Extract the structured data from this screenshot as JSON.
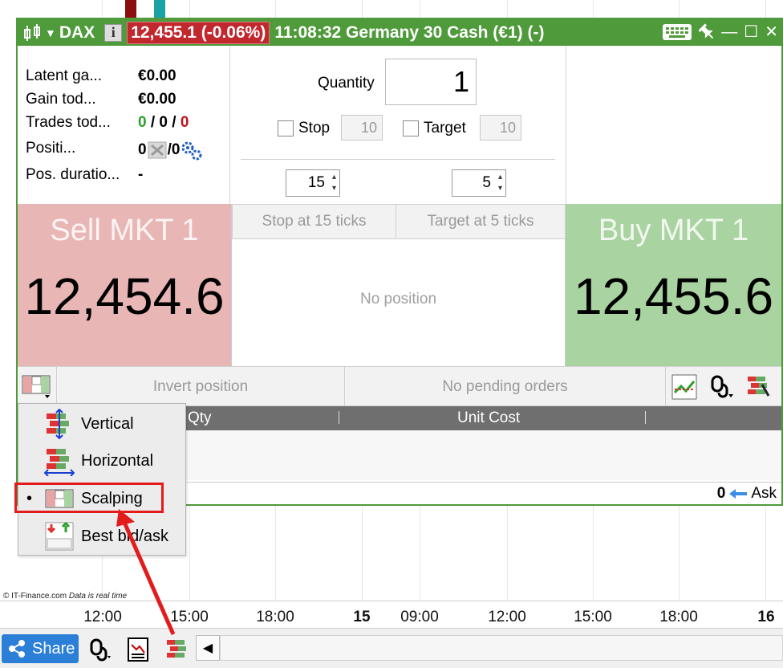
{
  "window": {
    "symbol": "DAX",
    "price_badge": "12,455.1 (-0.06%)",
    "time_and_name": "11:08:32 Germany 30 Cash (€1) (-)",
    "border_color": "#4f9a3a"
  },
  "stats": {
    "latent_gain_label": "Latent ga...",
    "latent_gain_value": "€0.00",
    "gain_today_label": "Gain tod...",
    "gain_today_value": "€0.00",
    "trades_today_label": "Trades tod...",
    "trades_won": "0",
    "trades_sep1": " / ",
    "trades_neutral": "0",
    "trades_sep2": " / ",
    "trades_lost": "0",
    "positions_label": "Positi...",
    "positions_long": "0",
    "positions_sep": " / ",
    "positions_short": "0",
    "pos_duration_label": "Pos. duratio...",
    "pos_duration_value": "-"
  },
  "order": {
    "quantity_label": "Quantity",
    "quantity_value": "1",
    "stop_label": "Stop",
    "stop_value": "10",
    "target_label": "Target",
    "target_value": "10",
    "stop_ticks": "15",
    "target_ticks": "5"
  },
  "trade": {
    "sell_label": "Sell MKT 1",
    "sell_price": "12,454.6",
    "buy_label": "Buy MKT 1",
    "buy_price": "12,455.6",
    "stop_button": "Stop at 15 ticks",
    "target_button": "Target at 5 ticks",
    "no_position": "No position",
    "invert_position": "Invert position",
    "no_pending_orders": "No pending orders"
  },
  "table": {
    "columns": [
      "Qty",
      "Unit Cost"
    ]
  },
  "status": {
    "ask_count": "0",
    "ask_label": "Ask"
  },
  "layout_menu": {
    "items": [
      {
        "label": "Vertical",
        "icon": "vertical-layout-icon",
        "selected": false
      },
      {
        "label": "Horizontal",
        "icon": "horizontal-layout-icon",
        "selected": false
      },
      {
        "label": "Scalping",
        "icon": "scalping-layout-icon",
        "selected": true
      },
      {
        "label": "Best bid/ask",
        "icon": "best-bid-ask-icon",
        "selected": false
      }
    ],
    "bullet": "•"
  },
  "chart": {
    "credit": "© IT-Finance.com",
    "credit_note": "Data is real time",
    "time_ticks": [
      "12:00",
      "15:00",
      "18:00",
      "15",
      "09:00",
      "12:00",
      "15:00",
      "18:00",
      "16"
    ]
  },
  "toolbar": {
    "share_label": "Share"
  },
  "colors": {
    "sell_bg": "#e8b6b4",
    "buy_bg": "#a9d3a0",
    "badge_red": "#c1272d",
    "highlight_red": "#e31b1b"
  }
}
